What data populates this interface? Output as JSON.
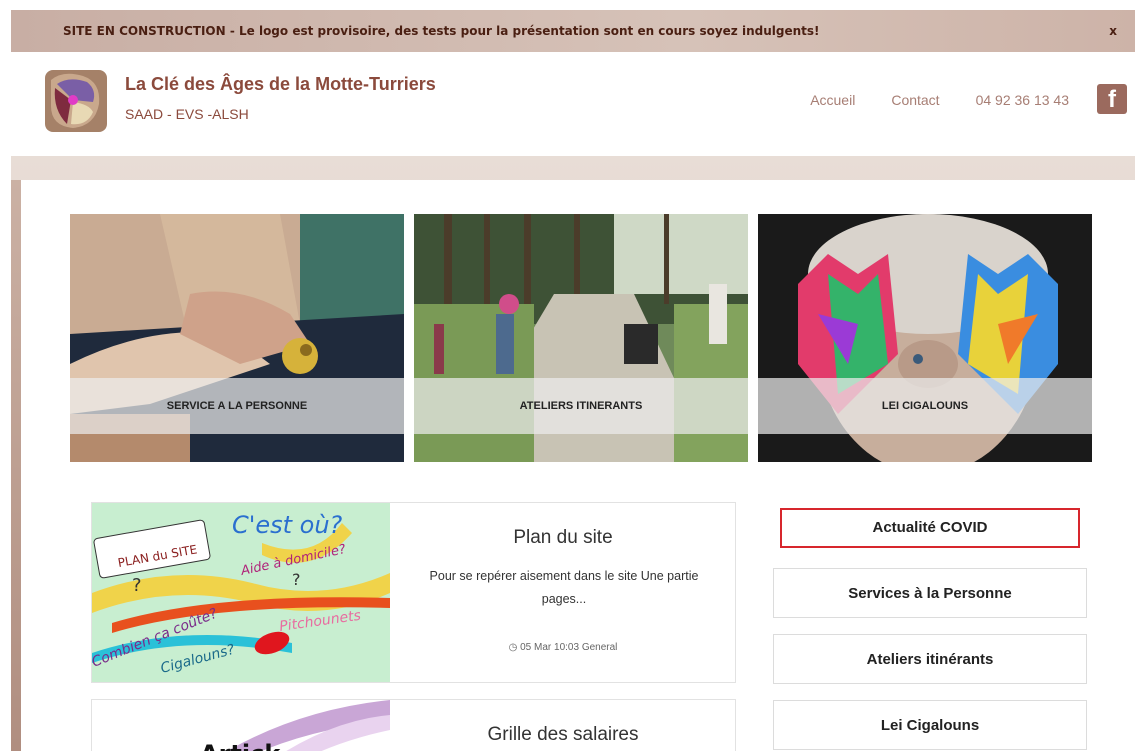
{
  "banner": {
    "text": "SITE EN CONSTRUCTION - Le logo est provisoire, des tests pour la présentation sont en cours soyez indulgents!",
    "close": "x"
  },
  "header": {
    "title": "La Clé des Âges de la Motte-Turriers",
    "subtitle": "SAAD - EVS -ALSH",
    "nav": [
      "Accueil",
      "Contact",
      "04 92 36 13 43"
    ],
    "facebook_icon": "facebook-icon"
  },
  "tiles": [
    {
      "label": "SERVICE A LA PERSONNE"
    },
    {
      "label": "ATELIERS ITINERANTS"
    },
    {
      "label": "LEI CIGALOUNS"
    }
  ],
  "cards": [
    {
      "title": "Plan du site",
      "desc": "Pour se repérer aisement dans le site Une partie pages...",
      "meta": "05 Mar 10:03 General",
      "thumb": {
        "c_est_ou": "C'est où?",
        "plan": "PLAN du SITE",
        "aide": "Aide à domicile?",
        "combien": "Combien ça coûte?",
        "cigalouns": "Cigalouns?",
        "pitchounets": "Pitchounets",
        "q1": "?",
        "q2": "?"
      }
    },
    {
      "title": "Grille des salaires",
      "thumb_text": "Artick"
    }
  ],
  "side_links": [
    "Actualité COVID",
    "Services à la Personne",
    "Ateliers itinérants",
    "Lei Cigalouns"
  ],
  "colors": {
    "banner_text": "#4a1f12",
    "title": "#8b4a3c",
    "nav": "#a77e74",
    "highlight": "#d7262d"
  }
}
